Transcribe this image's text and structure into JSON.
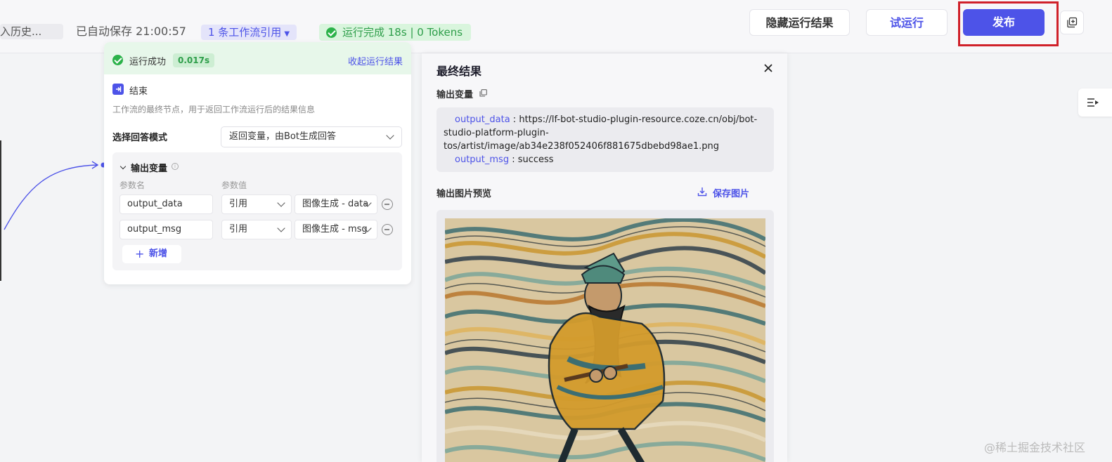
{
  "topbar": {
    "history_label": "入历史...",
    "autosave_text": "已自动保存 21:00:57",
    "workflow_ref": "1 条工作流引用",
    "run_status": "运行完成 18s | 0 Tokens",
    "hide_results_label": "隐藏运行结果",
    "try_run_label": "试运行",
    "publish_label": "发布"
  },
  "node": {
    "success_text": "运行成功",
    "time_badge": "0.017s",
    "collapse_label": "收起运行结果",
    "title": "结束",
    "description": "工作流的最终节点，用于返回工作流运行后的结果信息",
    "mode_label": "选择回答模式",
    "mode_value": "返回变量，由Bot生成回答",
    "output_title": "输出变量",
    "col_name": "参数名",
    "col_value": "参数值",
    "params": [
      {
        "name": "output_data",
        "ref": "引用",
        "value": "图像生成 - data"
      },
      {
        "name": "output_msg",
        "ref": "引用",
        "value": "图像生成 - msg"
      }
    ],
    "add_label": "新增"
  },
  "panel": {
    "title": "最终结果",
    "var_label": "输出变量",
    "output_data_key": "output_data",
    "output_data_sep": " : ",
    "output_data_line1": "https://lf-bot-studio-plugin-resource.coze.cn/obj/bot-",
    "output_data_line2": "studio-platform-plugin-",
    "output_data_line3": "tos/artist/image/ab34e238f052406f881675dbebd98ae1.png",
    "output_msg_key": "output_msg",
    "output_msg_value": " : success",
    "preview_label": "输出图片预览",
    "save_image_label": "保存图片"
  },
  "watermark": "@稀土掘金技术社区",
  "colors": {
    "accent": "#4d53e8",
    "success": "#2cb24a",
    "highlight": "#d0212a"
  }
}
